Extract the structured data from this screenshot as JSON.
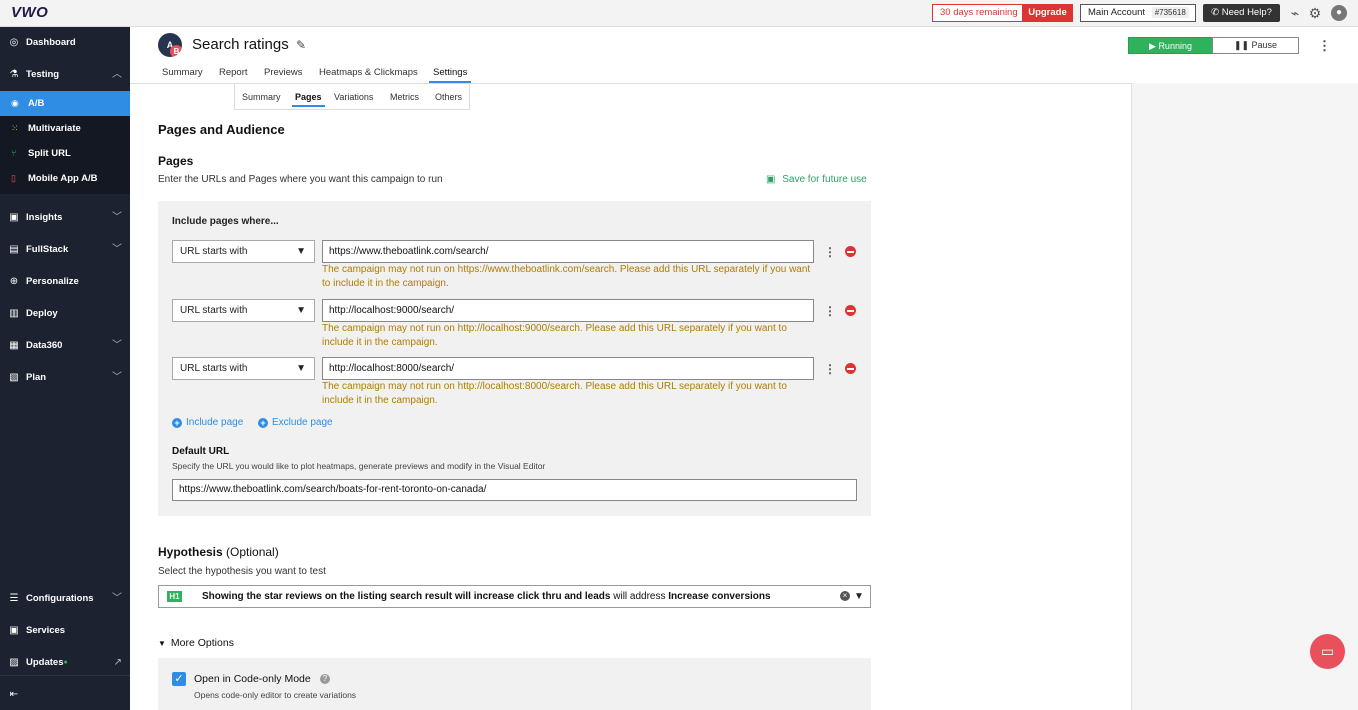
{
  "topbar": {
    "logo": "VWO",
    "trial": "30 days remaining",
    "upgrade": "Upgrade",
    "account_label": "Main Account",
    "account_id": "#735618",
    "help": "Need Help?"
  },
  "sidebar": {
    "dashboard": "Dashboard",
    "testing": "Testing",
    "sub": {
      "ab": "A/B",
      "multivariate": "Multivariate",
      "split": "Split URL",
      "mobile": "Mobile App A/B"
    },
    "insights": "Insights",
    "fullstack": "FullStack",
    "personalize": "Personalize",
    "deploy": "Deploy",
    "data360": "Data360",
    "plan": "Plan",
    "configurations": "Configurations",
    "services": "Services",
    "updates": "Updates"
  },
  "header": {
    "badge_a": "A",
    "badge_b": "B",
    "title": "Search ratings",
    "running": "Running",
    "pause": "Pause",
    "tabs": [
      "Summary",
      "Report",
      "Previews",
      "Heatmaps & Clickmaps",
      "Settings"
    ],
    "subtabs": [
      "Summary",
      "Pages",
      "Variations",
      "Metrics",
      "Others"
    ]
  },
  "section": {
    "title": "Pages and Audience",
    "pages_heading": "Pages",
    "pages_desc": "Enter the URLs and Pages where you want this campaign to run",
    "save_future": "Save for future use",
    "include_title": "Include pages where...",
    "rows": [
      {
        "match": "URL starts with",
        "url": "https://www.theboatlink.com/search/",
        "warning": "The campaign may not run on https://www.theboatlink.com/search. Please add this URL separately if you want to include it in the campaign."
      },
      {
        "match": "URL starts with",
        "url": "http://localhost:9000/search/",
        "warning": "The campaign may not run on http://localhost:9000/search. Please add this URL separately if you want to include it in the campaign."
      },
      {
        "match": "URL starts with",
        "url": "http://localhost:8000/search/",
        "warning": "The campaign may not run on http://localhost:8000/search. Please add this URL separately if you want to include it in the campaign."
      }
    ],
    "include_page": "Include page",
    "exclude_page": "Exclude page",
    "default_title": "Default URL",
    "default_desc": "Specify the URL you would like to plot heatmaps, generate previews and modify in the Visual Editor",
    "default_url": "https://www.theboatlink.com/search/boats-for-rent-toronto-on-canada/"
  },
  "hypothesis": {
    "title": "Hypothesis",
    "optional": "(Optional)",
    "desc": "Select the hypothesis you want to test",
    "tag": "H1",
    "text_bold": "Showing the star reviews on the listing search result will increase click thru and leads",
    "text_mid": " will address ",
    "text_bold2": "Increase conversions"
  },
  "more": {
    "label": "More Options",
    "code_label": "Open in Code-only Mode",
    "code_desc": "Opens code-only editor to create variations"
  },
  "colors": {
    "accent": "#2f8de4",
    "running": "#2eb25c",
    "danger": "#dd3333",
    "warning": "#b07d00",
    "sidebar": "#1c2230"
  }
}
